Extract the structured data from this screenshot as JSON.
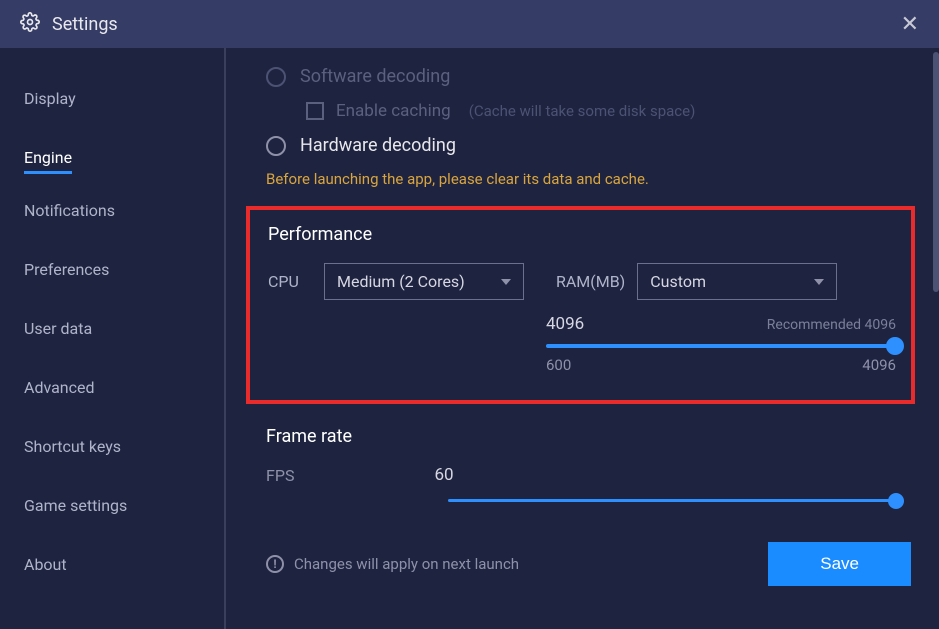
{
  "titlebar": {
    "title": "Settings"
  },
  "sidebar": {
    "items": [
      {
        "label": "Display"
      },
      {
        "label": "Engine"
      },
      {
        "label": "Notifications"
      },
      {
        "label": "Preferences"
      },
      {
        "label": "User data"
      },
      {
        "label": "Advanced"
      },
      {
        "label": "Shortcut keys"
      },
      {
        "label": "Game settings"
      },
      {
        "label": "About"
      }
    ],
    "active_index": 1
  },
  "decoding": {
    "software_label": "Software decoding",
    "hardware_label": "Hardware decoding",
    "enable_caching_label": "Enable caching",
    "caching_hint": "(Cache will take some disk space)",
    "warning": "Before launching the app, please clear its data and cache."
  },
  "performance": {
    "section_title": "Performance",
    "cpu_label": "CPU",
    "cpu_value": "Medium (2 Cores)",
    "ram_label": "RAM(MB)",
    "ram_value": "Custom",
    "ram_current": "4096",
    "ram_recommended": "Recommended 4096",
    "ram_min": "600",
    "ram_max": "4096"
  },
  "framerate": {
    "section_title": "Frame rate",
    "fps_label": "FPS",
    "fps_value": "60"
  },
  "footer": {
    "note": "Changes will apply on next launch",
    "save_label": "Save"
  },
  "colors": {
    "accent": "#1a8cff",
    "warning": "#d9a53e",
    "highlight_border": "#ea2b2b",
    "bg": "#1e2340",
    "titlebar_bg": "#353c66"
  }
}
